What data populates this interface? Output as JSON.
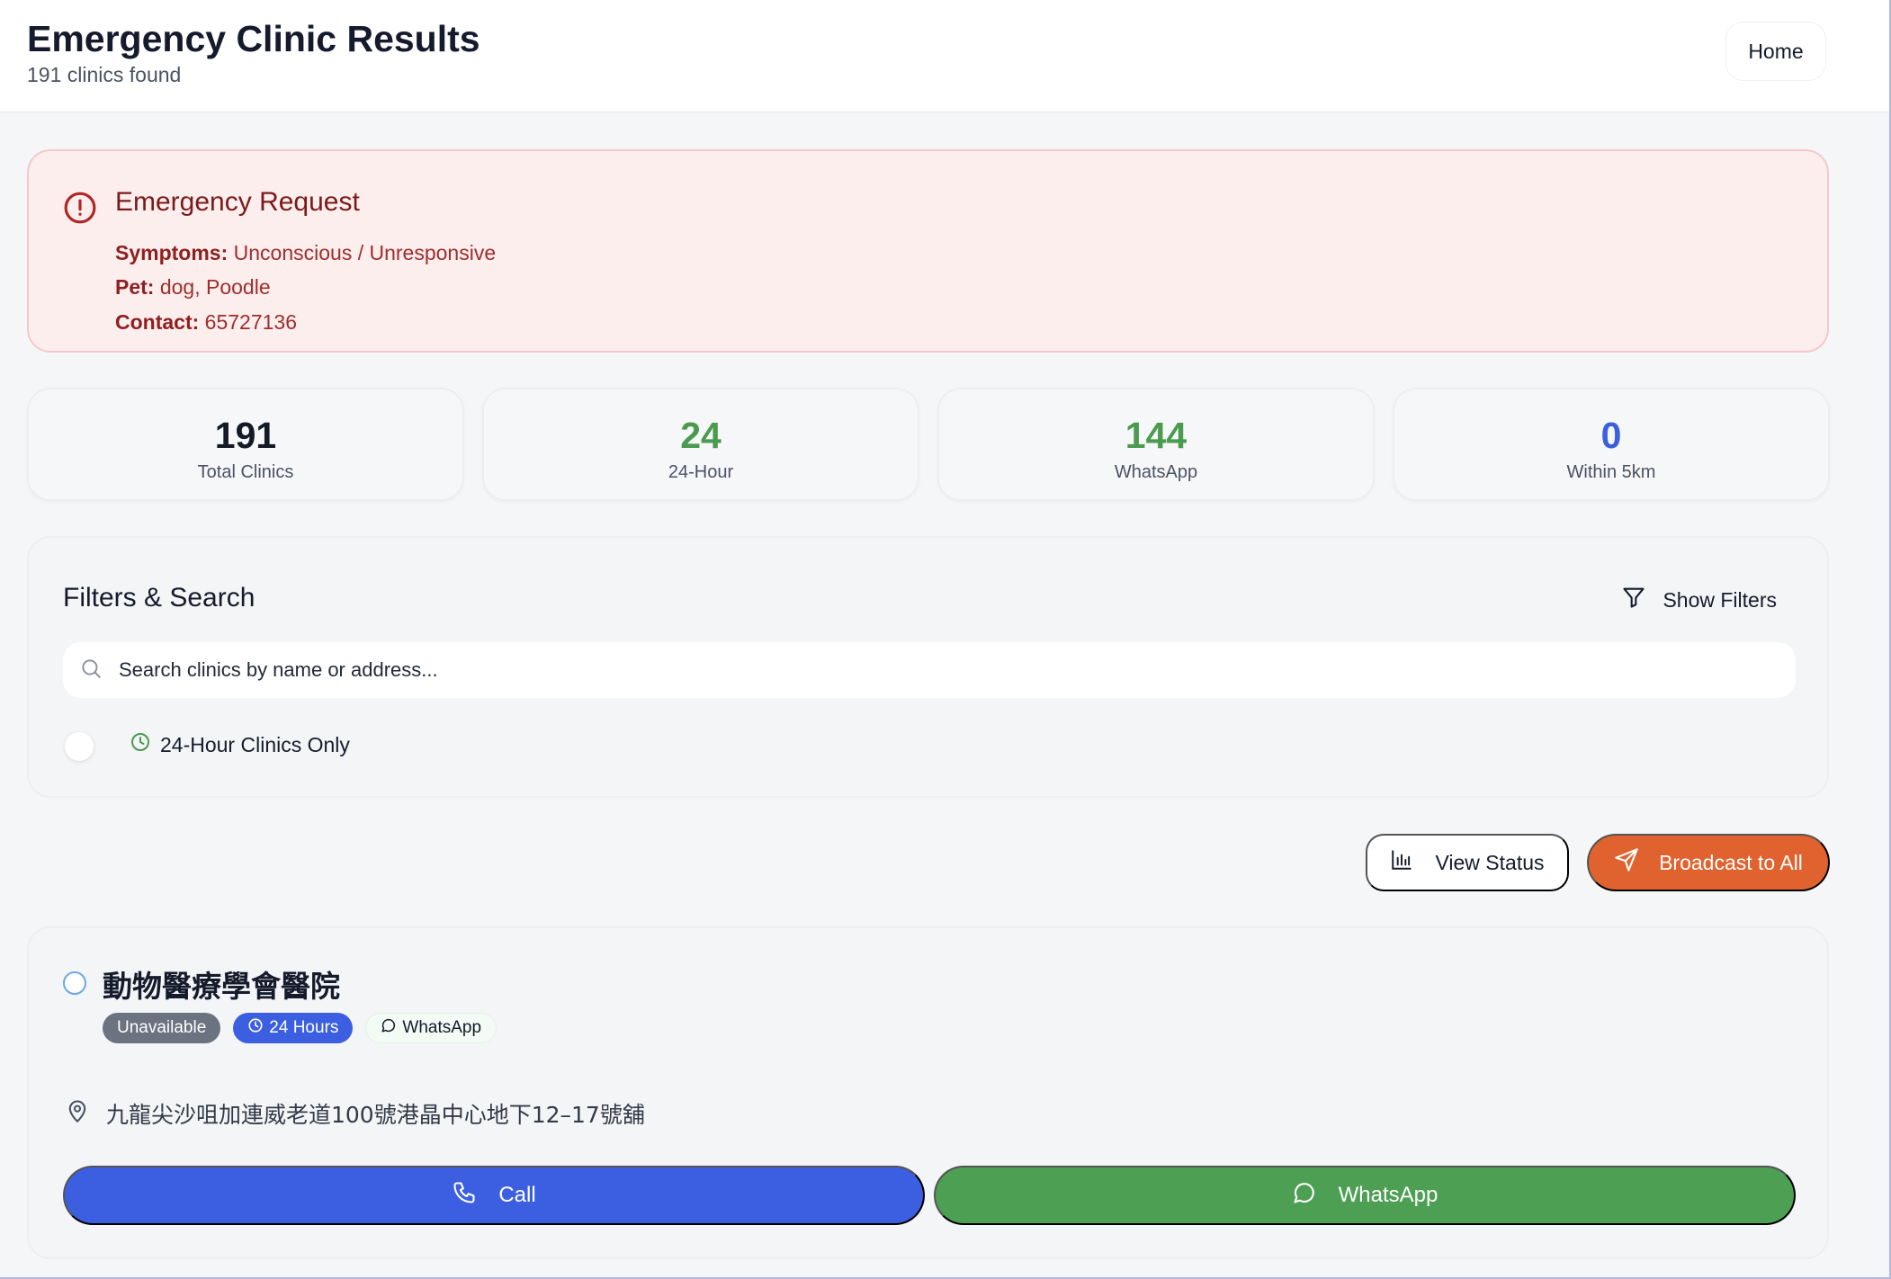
{
  "header": {
    "title": "Emergency Clinic Results",
    "subtitle": "191 clinics found",
    "home_label": "Home"
  },
  "emergency": {
    "title": "Emergency Request",
    "symptoms_label": "Symptoms:",
    "symptoms_value": "Unconscious / Unresponsive",
    "pet_label": "Pet:",
    "pet_value": "dog, Poodle",
    "contact_label": "Contact:",
    "contact_value": "65727136"
  },
  "stats": [
    {
      "value": "191",
      "label": "Total Clinics",
      "color": "#141a26"
    },
    {
      "value": "24",
      "label": "24-Hour",
      "color": "#4a9b4f"
    },
    {
      "value": "144",
      "label": "WhatsApp",
      "color": "#4a9b4f"
    },
    {
      "value": "0",
      "label": "Within 5km",
      "color": "#3b5fe0"
    }
  ],
  "filters": {
    "title": "Filters & Search",
    "show_filters_label": "Show Filters",
    "search_placeholder": "Search clinics by name or address...",
    "toggle_24h_label": "24-Hour Clinics Only",
    "toggle_24h_on": false
  },
  "actions": {
    "view_status_label": "View Status",
    "broadcast_label": "Broadcast to All"
  },
  "clinic": {
    "name": "動物醫療學會醫院",
    "badges": {
      "unavailable": "Unavailable",
      "hours": "24 Hours",
      "whatsapp": "WhatsApp"
    },
    "address": "九龍尖沙咀加連威老道100號港晶中心地下12–17號舖",
    "call_label": "Call",
    "whatsapp_label": "WhatsApp"
  },
  "colors": {
    "accent_blue": "#3b5fe0",
    "accent_green": "#4d9f53",
    "accent_orange": "#e0632f",
    "alert_red": "#b42323"
  },
  "icons": [
    "alert-circle-icon",
    "filter-icon",
    "search-icon",
    "clock-icon",
    "bar-chart-icon",
    "send-icon",
    "map-pin-icon",
    "phone-icon",
    "message-circle-icon"
  ]
}
